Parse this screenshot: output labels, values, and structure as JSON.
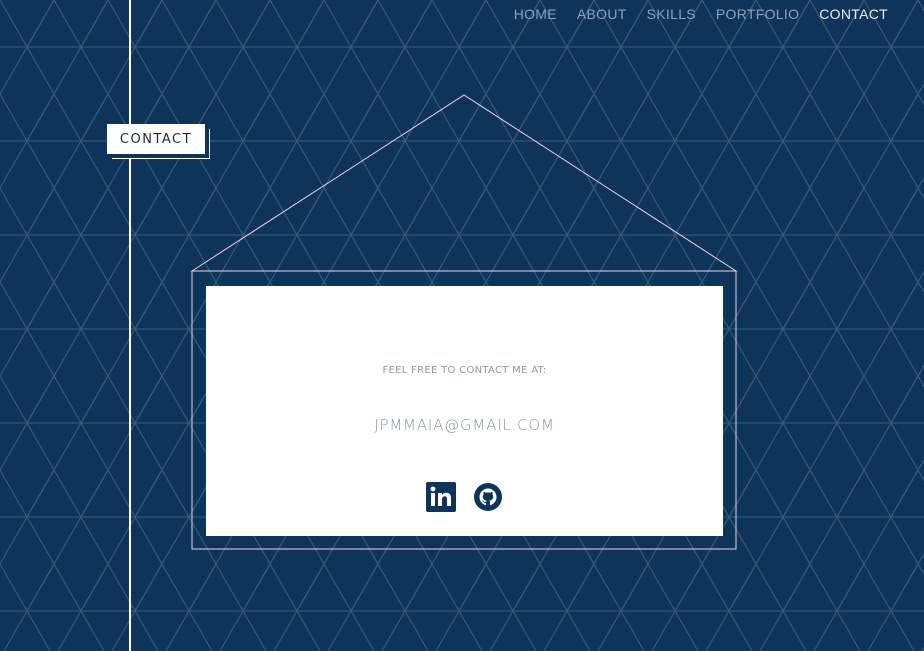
{
  "nav": {
    "items": [
      {
        "label": "HOME"
      },
      {
        "label": "ABOUT"
      },
      {
        "label": "SKILLS"
      },
      {
        "label": "PORTFOLIO"
      },
      {
        "label": "CONTACT",
        "active": true
      }
    ]
  },
  "section": {
    "label": "CONTACT"
  },
  "contact": {
    "intro": "FEEL FREE TO CONTACT ME AT:",
    "email": "JPMMAIA@GMAIL.COM",
    "icons": [
      "linkedin-icon",
      "github-icon"
    ]
  },
  "colors": {
    "background": "#0e3559",
    "pattern_line": "#3b5b80",
    "card": "#ffffff",
    "outline": "#e8d3e6",
    "icon": "#0e3559"
  }
}
